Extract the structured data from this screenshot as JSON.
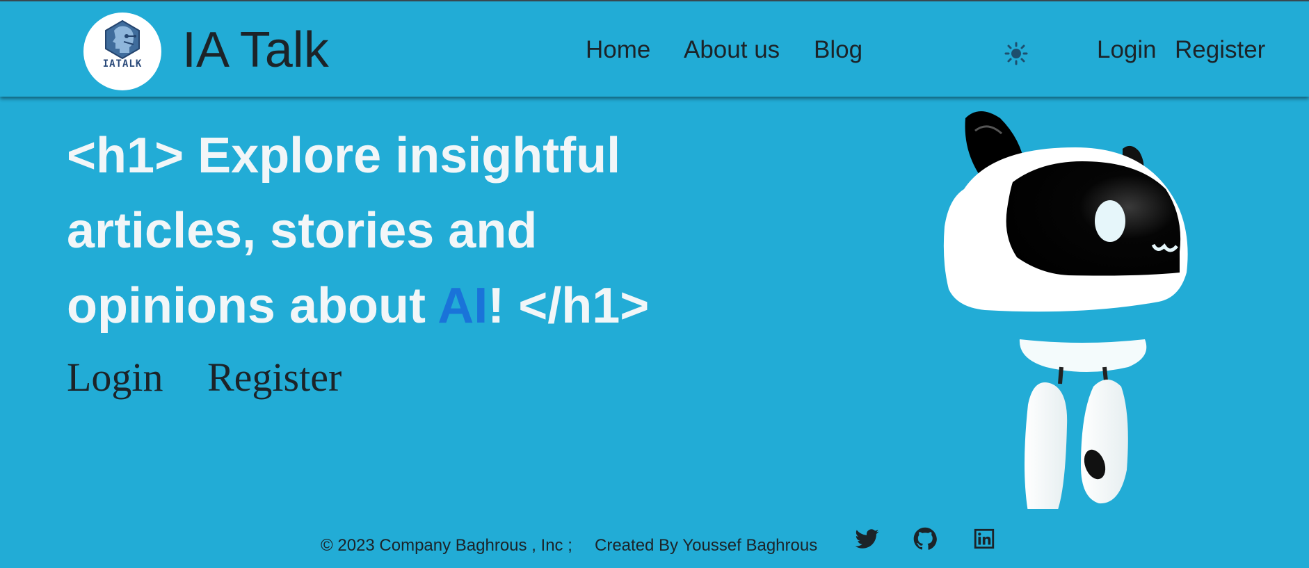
{
  "header": {
    "logo_text": "IATALK",
    "brand": "IA Talk",
    "nav": [
      "Home",
      "About us",
      "Blog"
    ],
    "theme_toggle_icon": "sun-icon",
    "auth": {
      "login": "Login",
      "register": "Register"
    }
  },
  "hero": {
    "title_before": "<h1> Explore insightful articles, stories and opinions about ",
    "title_highlight": "AI",
    "title_after": "! </h1>",
    "cta_login": "Login",
    "cta_register": "Register"
  },
  "footer": {
    "copyright": "© 2023 Company Baghrous , Inc ;",
    "credit": "Created By Youssef Baghrous",
    "social_icons": [
      "twitter-icon",
      "github-icon",
      "linkedin-icon"
    ]
  },
  "colors": {
    "background": "#22acd6",
    "text_dark": "#1c2328",
    "hero_text": "#f2f6f8",
    "highlight": "#1a73d9"
  }
}
